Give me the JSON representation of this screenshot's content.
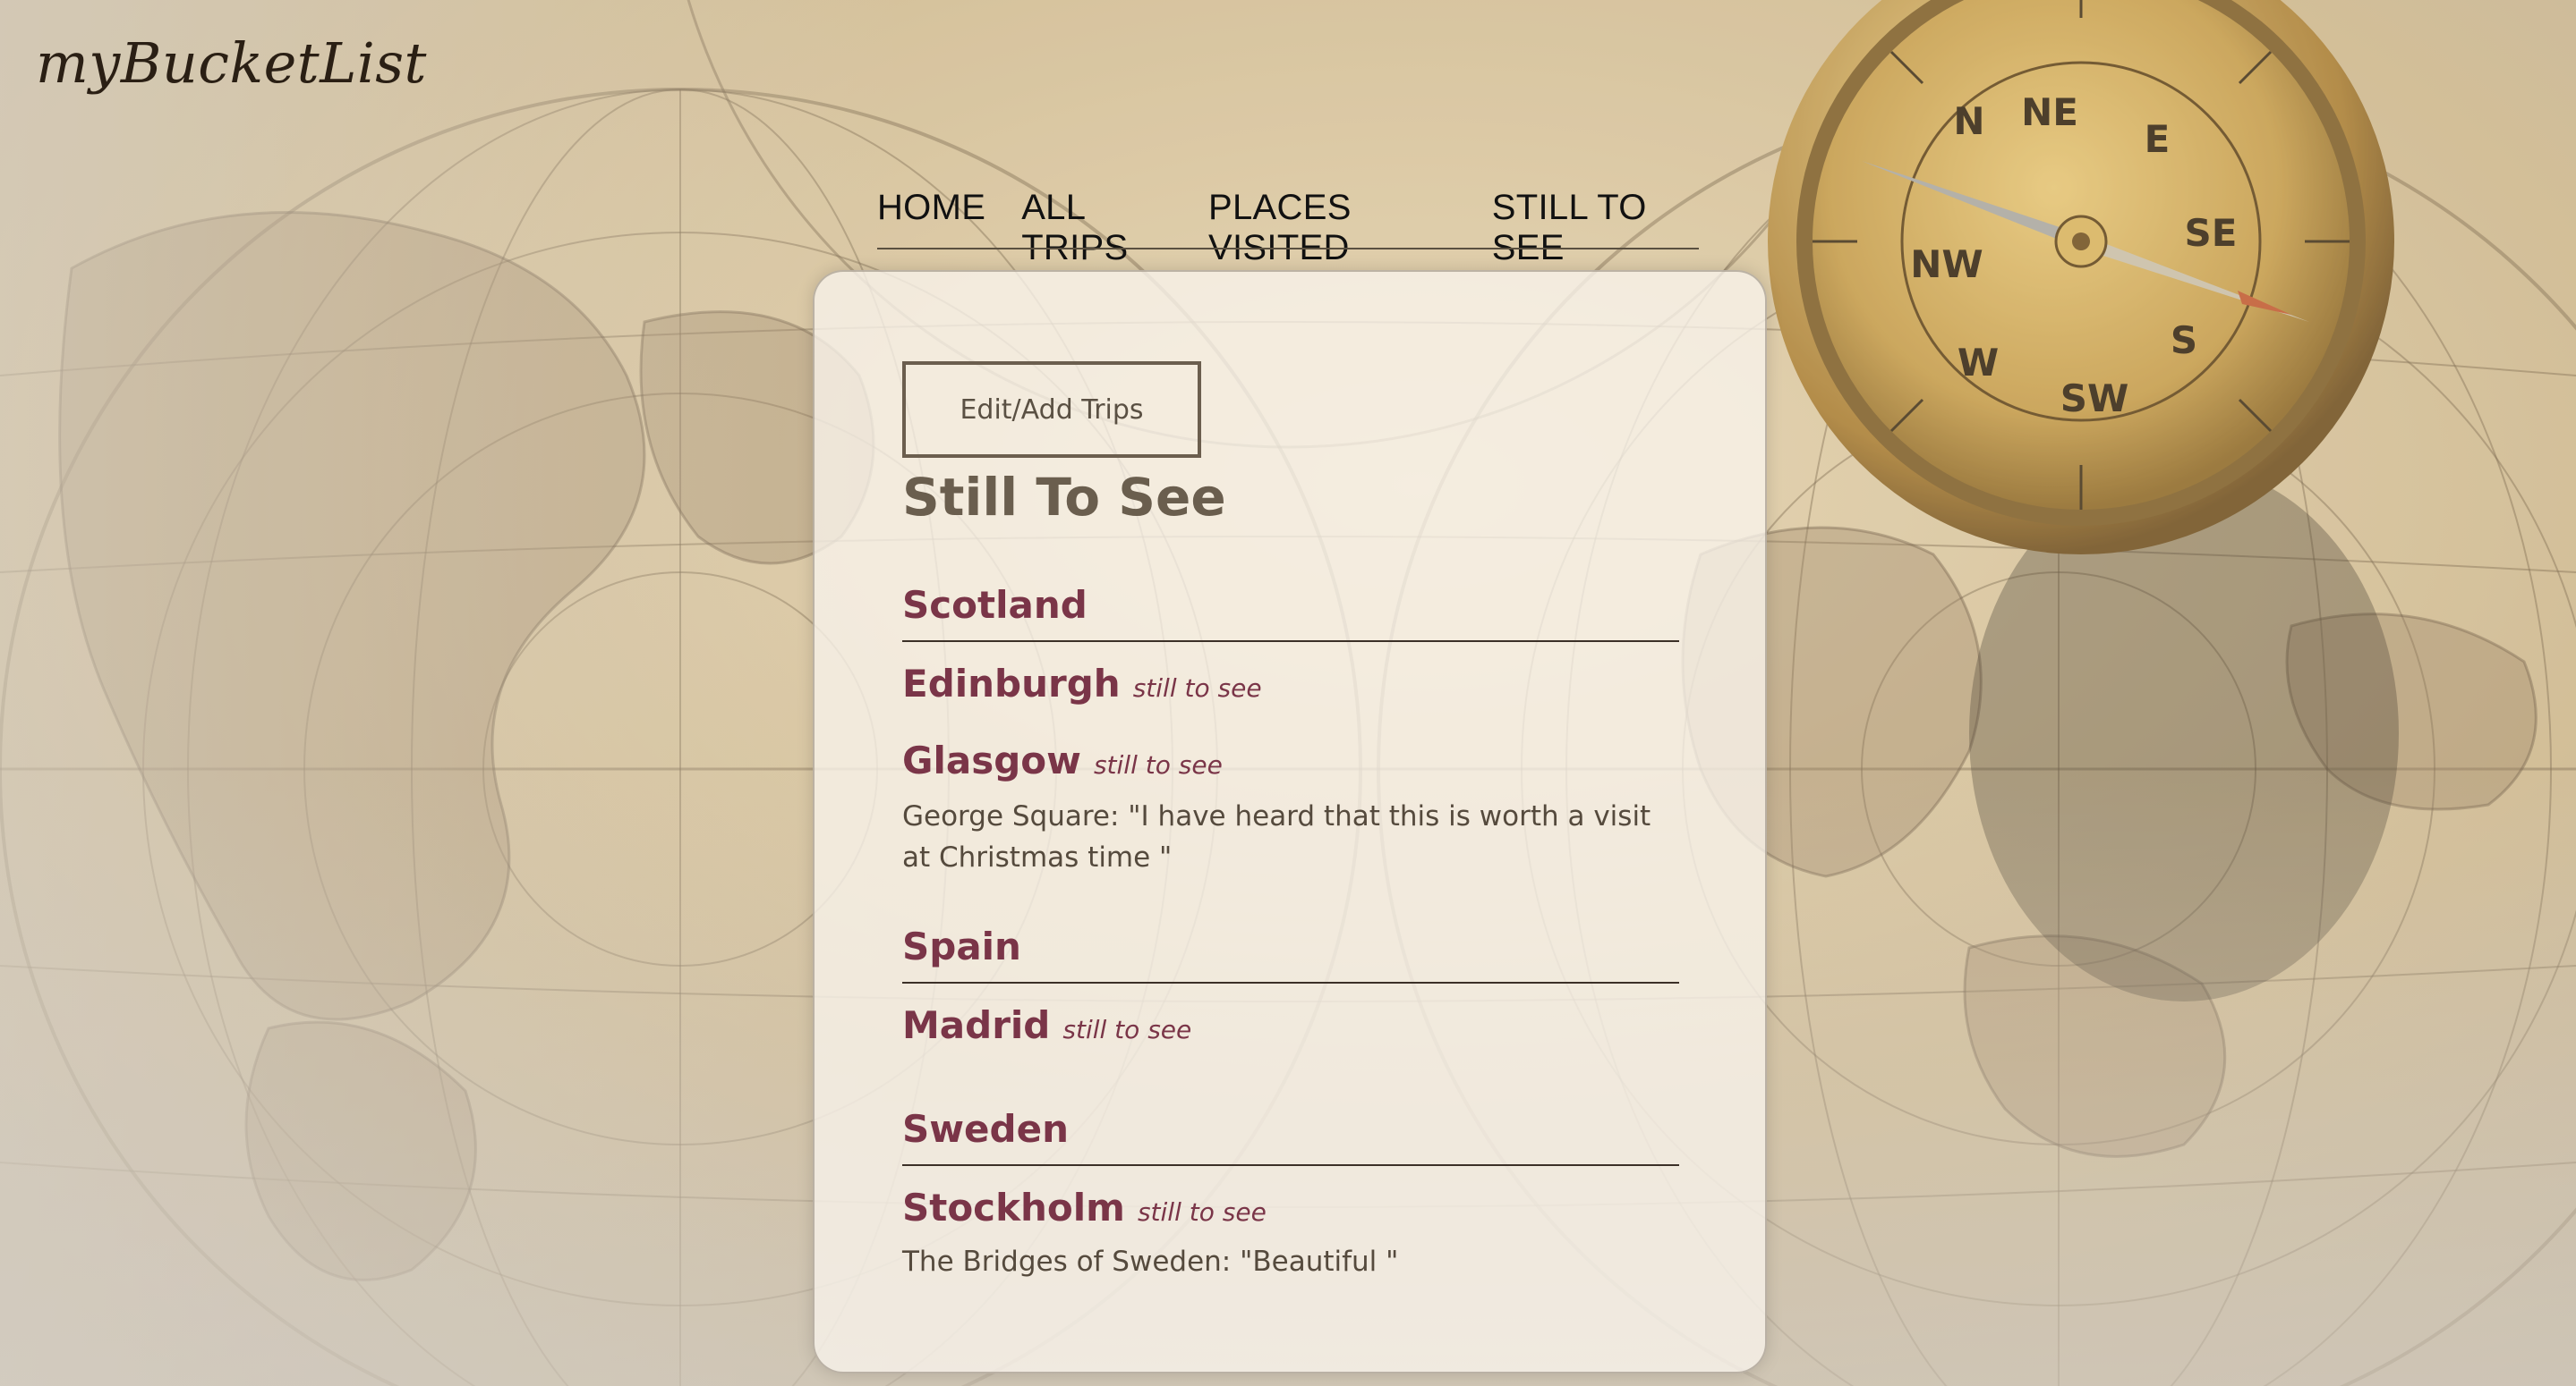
{
  "brand": {
    "title": "myBucketList"
  },
  "nav": {
    "items": [
      "HOME",
      "ALL TRIPS",
      "PLACES VISITED",
      "STILL TO SEE"
    ]
  },
  "panel": {
    "edit_button": "Edit/Add Trips",
    "title": "Still To See",
    "countries": [
      {
        "name": "Scotland",
        "cities": [
          {
            "name": "Edinburgh",
            "status": "still to see",
            "note": ""
          },
          {
            "name": "Glasgow",
            "status": "still to see",
            "note": "George Square: \"I have heard that this is worth a visit at Christmas time \""
          }
        ]
      },
      {
        "name": "Spain",
        "cities": [
          {
            "name": "Madrid",
            "status": "still to see",
            "note": ""
          }
        ]
      },
      {
        "name": "Sweden",
        "cities": [
          {
            "name": "Stockholm",
            "status": "still to see",
            "note": "The Bridges of Sweden: \"Beautiful \""
          }
        ]
      }
    ]
  },
  "colors": {
    "accent": "#7a3548",
    "heading": "#6a5e4e",
    "map_base": "#d9c7a4",
    "compass_brass": "#b8923e"
  },
  "icons": {
    "compass": "compass-icon"
  }
}
